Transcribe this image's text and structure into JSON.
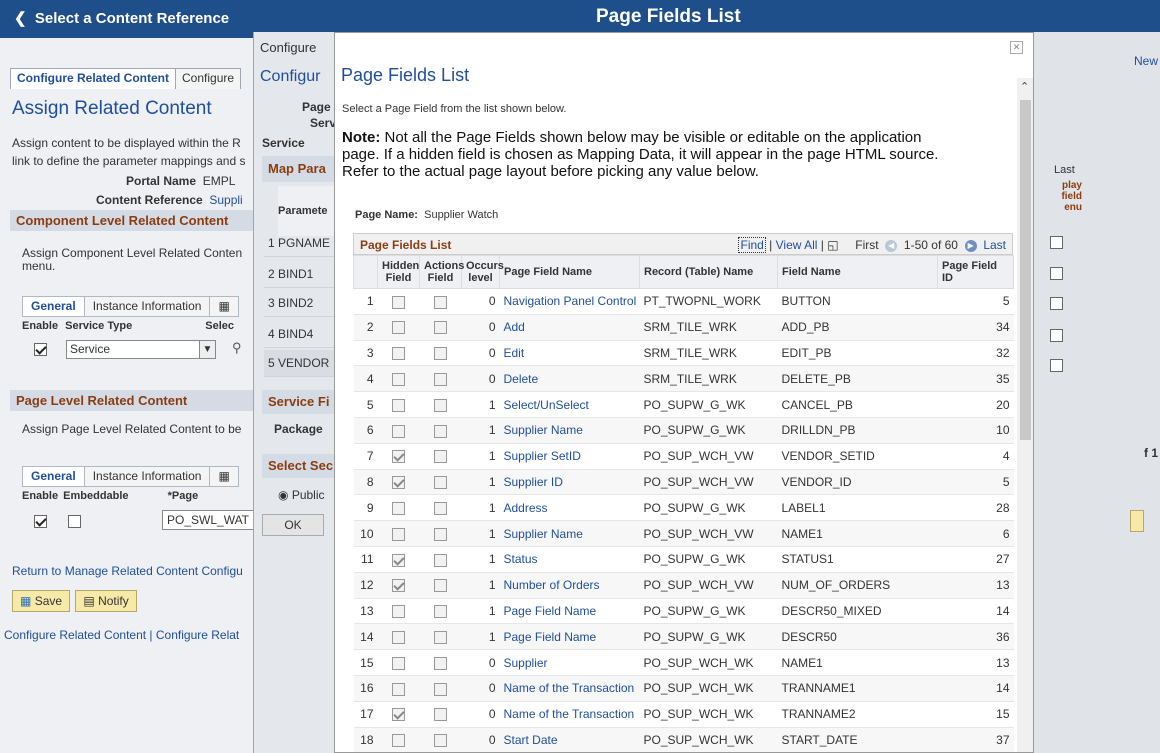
{
  "topbar": {
    "back_label": "Select a Content Reference",
    "title": "Page Fields List"
  },
  "left": {
    "tabs": [
      "Configure Related Content",
      "Configure"
    ],
    "heading": "Assign Related Content",
    "desc1": "Assign content to be displayed within the R",
    "desc2": "link to define the parameter mappings and s",
    "portal_label": "Portal Name",
    "portal_value": "EMPL",
    "content_ref_label": "Content Reference",
    "content_ref_value": "Suppli",
    "component_section": "Component Level Related Content",
    "component_desc1": "Assign Component Level Related Conten",
    "component_desc2": "menu.",
    "comp_tabs": [
      "General",
      "Instance Information"
    ],
    "comp_col_enable": "Enable",
    "comp_col_service": "Service Type",
    "comp_col_sel": "Selec",
    "comp_service_value": "Service",
    "page_section": "Page Level Related Content",
    "page_desc": "Assign Page Level Related Content to be",
    "page_tabs": [
      "General",
      "Instance Information"
    ],
    "page_col_enable": "Enable",
    "page_col_embed": "Embeddable",
    "page_col_page": "*Page",
    "page_value": "PO_SWL_WAT",
    "return_link": "Return to Manage Related Content Configu",
    "save_label": "Save",
    "notify_label": "Notify",
    "footer_links": "Configure Related Content | Configure Relat"
  },
  "mid": {
    "tab": "Configure",
    "heading": "Configur",
    "lbl_page": "Page",
    "lbl_serv": "Serv",
    "lbl_service": "Service",
    "map_section": "Map Para",
    "col_param": "Paramete",
    "rows": [
      "1 PGNAME",
      "2 BIND1",
      "3 BIND2",
      "4 BIND4",
      "5 VENDOR"
    ],
    "service_section": "Service Fi",
    "package_label": "Package",
    "select_section": "Select Sec",
    "public_label": "Public",
    "ok_label": "OK"
  },
  "right": {
    "new_label": "New",
    "last_label": "Last",
    "display_label": "play field enu",
    "page_count": "f 1"
  },
  "modal": {
    "title": "Page Fields List",
    "subtitle": "Select a Page Field from the list shown below.",
    "note_label": "Note:",
    "note_text": " Not all the Page Fields shown below may be visible or editable on the application page. If a hidden field is chosen as Mapping Data, it will appear in the page HTML source. Refer to the actual page layout before picking any value below.",
    "page_name_label": "Page Name:",
    "page_name_value": "Supplier Watch",
    "grid_title": "Page Fields List",
    "find_label": "Find",
    "viewall_label": "View All",
    "first_label": "First",
    "range_label": "1-50 of 60",
    "last_label": "Last",
    "columns": [
      "",
      "Hidden Field",
      "Actions Field",
      "Occurs level",
      "Page Field Name",
      "Record (Table) Name",
      "Field Name",
      "Page Field ID"
    ],
    "rows": [
      {
        "n": "1",
        "hidden": false,
        "actions": false,
        "occurs": "0",
        "name": "Navigation Panel Control",
        "record": "PT_TWOPNL_WORK",
        "field": "BUTTON",
        "id": "5"
      },
      {
        "n": "2",
        "hidden": false,
        "actions": false,
        "occurs": "0",
        "name": "Add",
        "record": "SRM_TILE_WRK",
        "field": "ADD_PB",
        "id": "34"
      },
      {
        "n": "3",
        "hidden": false,
        "actions": false,
        "occurs": "0",
        "name": "Edit",
        "record": "SRM_TILE_WRK",
        "field": "EDIT_PB",
        "id": "32"
      },
      {
        "n": "4",
        "hidden": false,
        "actions": false,
        "occurs": "0",
        "name": "Delete",
        "record": "SRM_TILE_WRK",
        "field": "DELETE_PB",
        "id": "35"
      },
      {
        "n": "5",
        "hidden": false,
        "actions": false,
        "occurs": "1",
        "name": "Select/UnSelect",
        "record": "PO_SUPW_G_WK",
        "field": "CANCEL_PB",
        "id": "20"
      },
      {
        "n": "6",
        "hidden": false,
        "actions": false,
        "occurs": "1",
        "name": "Supplier Name",
        "record": "PO_SUPW_G_WK",
        "field": "DRILLDN_PB",
        "id": "10"
      },
      {
        "n": "7",
        "hidden": true,
        "actions": false,
        "occurs": "1",
        "name": "Supplier SetID",
        "record": "PO_SUP_WCH_VW",
        "field": "VENDOR_SETID",
        "id": "4"
      },
      {
        "n": "8",
        "hidden": true,
        "actions": false,
        "occurs": "1",
        "name": "Supplier ID",
        "record": "PO_SUP_WCH_VW",
        "field": "VENDOR_ID",
        "id": "5"
      },
      {
        "n": "9",
        "hidden": false,
        "actions": false,
        "occurs": "1",
        "name": "Address",
        "record": "PO_SUPW_G_WK",
        "field": "LABEL1",
        "id": "28"
      },
      {
        "n": "10",
        "hidden": false,
        "actions": false,
        "occurs": "1",
        "name": "Supplier Name",
        "record": "PO_SUP_WCH_VW",
        "field": "NAME1",
        "id": "6"
      },
      {
        "n": "11",
        "hidden": true,
        "actions": false,
        "occurs": "1",
        "name": "Status",
        "record": "PO_SUPW_G_WK",
        "field": "STATUS1",
        "id": "27"
      },
      {
        "n": "12",
        "hidden": true,
        "actions": false,
        "occurs": "1",
        "name": "Number of Orders",
        "record": "PO_SUP_WCH_VW",
        "field": "NUM_OF_ORDERS",
        "id": "13"
      },
      {
        "n": "13",
        "hidden": false,
        "actions": false,
        "occurs": "1",
        "name": "Page Field Name",
        "record": "PO_SUPW_G_WK",
        "field": "DESCR50_MIXED",
        "id": "14"
      },
      {
        "n": "14",
        "hidden": false,
        "actions": false,
        "occurs": "1",
        "name": "Page Field Name",
        "record": "PO_SUPW_G_WK",
        "field": "DESCR50",
        "id": "36"
      },
      {
        "n": "15",
        "hidden": false,
        "actions": false,
        "occurs": "0",
        "name": "Supplier",
        "record": "PO_SUP_WCH_WK",
        "field": "NAME1",
        "id": "13"
      },
      {
        "n": "16",
        "hidden": false,
        "actions": false,
        "occurs": "0",
        "name": "Name of the Transaction",
        "record": "PO_SUP_WCH_WK",
        "field": "TRANNAME1",
        "id": "14"
      },
      {
        "n": "17",
        "hidden": true,
        "actions": false,
        "occurs": "0",
        "name": "Name of the Transaction",
        "record": "PO_SUP_WCH_WK",
        "field": "TRANNAME2",
        "id": "15"
      },
      {
        "n": "18",
        "hidden": false,
        "actions": false,
        "occurs": "0",
        "name": "Start Date",
        "record": "PO_SUP_WCH_WK",
        "field": "START_DATE",
        "id": "37"
      }
    ]
  }
}
